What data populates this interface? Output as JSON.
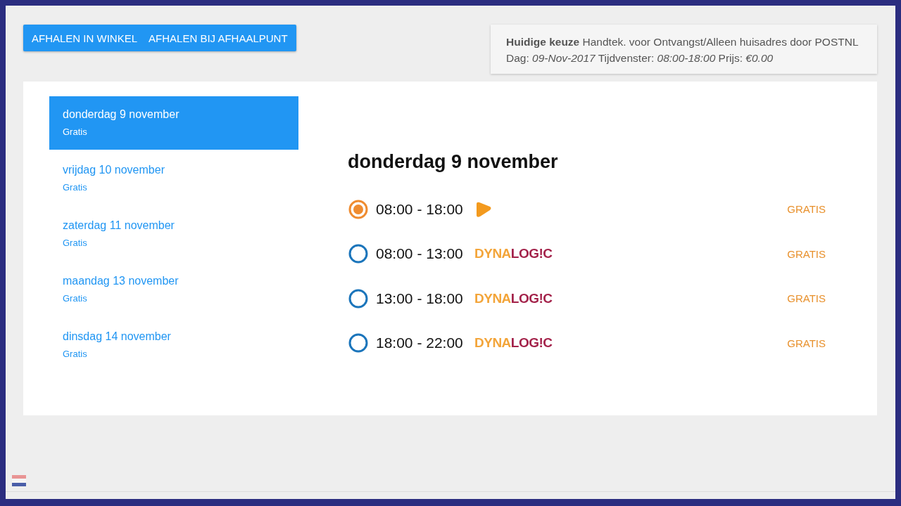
{
  "delivery_tabs": [
    "AFHALEN IN WINKEL",
    "AFHALEN BIJ AFHAALPUNT"
  ],
  "current_choice": {
    "label": "Huidige keuze",
    "method": "Handtek. voor Ontvangst/Alleen huisadres door POSTNL",
    "day_label": "Dag:",
    "day": "09-Nov-2017",
    "window_label": "Tijdvenster:",
    "window": "08:00-18:00",
    "price_label": "Prijs:",
    "price": "€0.00"
  },
  "dates": [
    {
      "label": "donderdag 9 november",
      "price": "Gratis",
      "selected": true
    },
    {
      "label": "vrijdag 10 november",
      "price": "Gratis",
      "selected": false
    },
    {
      "label": "zaterdag 11 november",
      "price": "Gratis",
      "selected": false
    },
    {
      "label": "maandag 13 november",
      "price": "Gratis",
      "selected": false
    },
    {
      "label": "dinsdag 14 november",
      "price": "Gratis",
      "selected": false
    }
  ],
  "day_heading": "donderdag 9 november",
  "slots": [
    {
      "time": "08:00 - 18:00",
      "selected": true,
      "carrier": {
        "kind": "postnl"
      },
      "price": "GRATIS"
    },
    {
      "time": "08:00 - 13:00",
      "selected": false,
      "carrier": {
        "kind": "dynalogic",
        "name_a": "DYNA",
        "name_b": "LOG!C"
      },
      "price": "GRATIS"
    },
    {
      "time": "13:00 - 18:00",
      "selected": false,
      "carrier": {
        "kind": "dynalogic",
        "name_a": "DYNA",
        "name_b": "LOG!C"
      },
      "price": "GRATIS"
    },
    {
      "time": "18:00 - 22:00",
      "selected": false,
      "carrier": {
        "kind": "dynalogic",
        "name_a": "DYNA",
        "name_b": "LOG!C"
      },
      "price": "GRATIS"
    }
  ]
}
